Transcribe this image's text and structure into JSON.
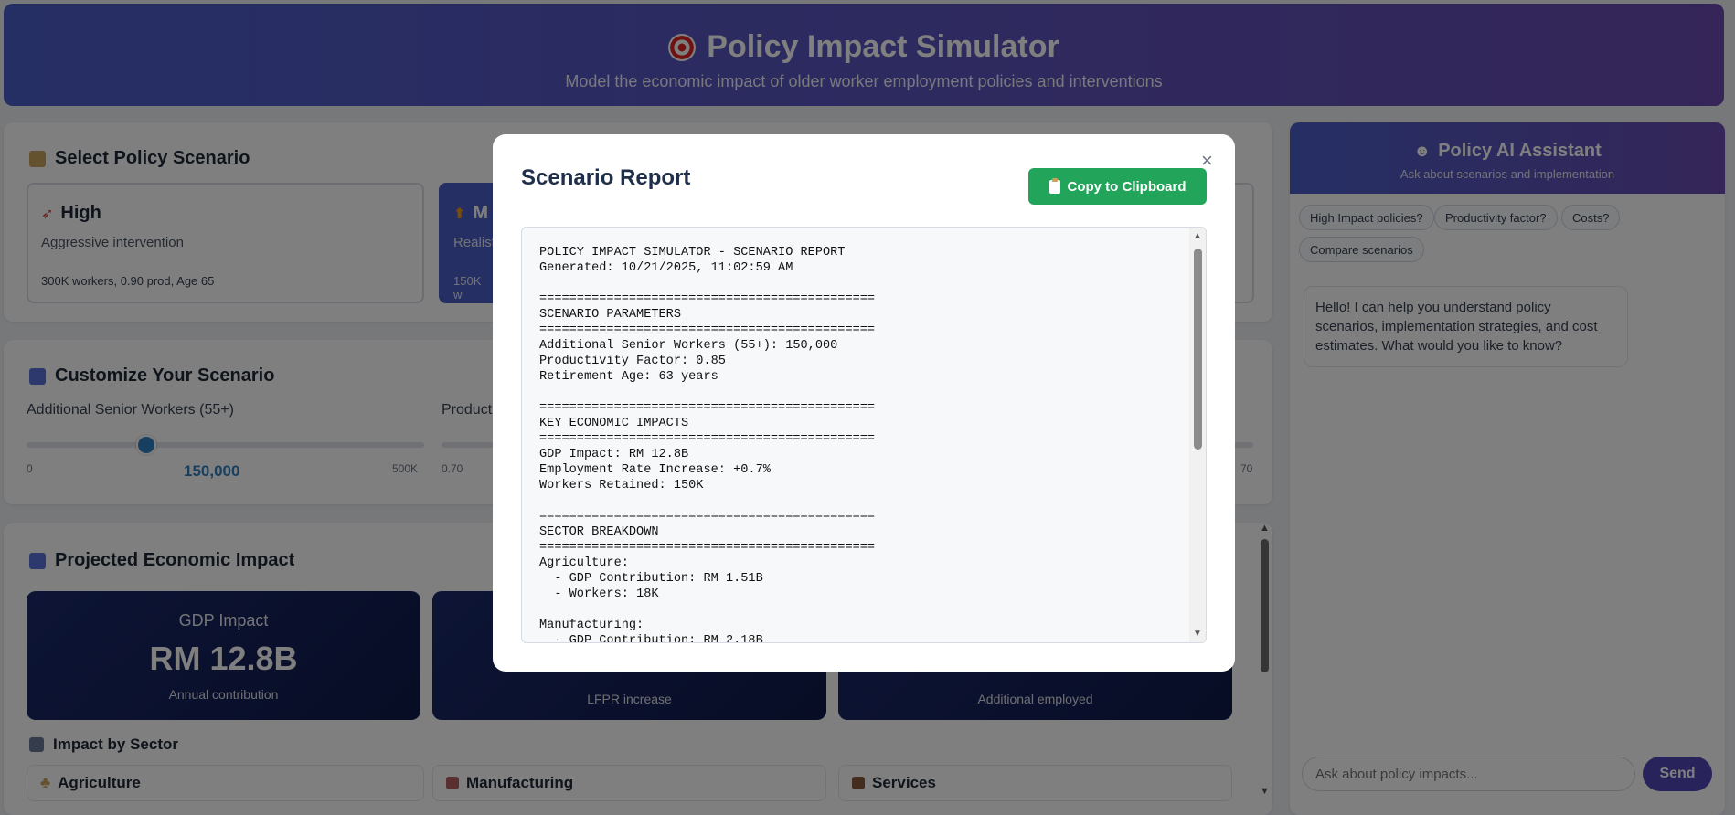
{
  "header": {
    "title": "Policy Impact Simulator",
    "subtitle": "Model the economic impact of older worker employment policies and interventions"
  },
  "scenario_section": {
    "title": "Select Policy Scenario",
    "cards": [
      {
        "name": "High",
        "desc": "Aggressive intervention",
        "meta": "300K workers, 0.90 prod, Age 65"
      },
      {
        "name": "M",
        "desc": "Realist",
        "meta": "150K w"
      }
    ]
  },
  "customize_section": {
    "title": "Customize Your Scenario",
    "sliders": [
      {
        "label": "Additional Senior Workers (55+)",
        "min": "0",
        "max": "500K",
        "value": "150,000",
        "fraction": 0.3
      },
      {
        "label": "Product",
        "min": "0.70",
        "max": "70"
      }
    ]
  },
  "impact_section": {
    "title": "Projected Economic Impact",
    "metrics": [
      {
        "label": "GDP Impact",
        "value": "RM 12.8B",
        "sub": "Annual contribution"
      },
      {
        "label": "",
        "value": "",
        "sub": "LFPR increase"
      },
      {
        "label": "",
        "value": "",
        "sub": "Additional employed"
      }
    ],
    "sector_title": "Impact by Sector",
    "sectors": [
      "Agriculture",
      "Manufacturing",
      "Services"
    ]
  },
  "chat": {
    "title": "Policy AI Assistant",
    "subtitle": "Ask about scenarios and implementation",
    "chips": [
      "High Impact policies?",
      "Productivity factor?",
      "Costs?",
      "Compare scenarios"
    ],
    "greeting": "Hello! I can help you understand policy scenarios, implementation strategies, and cost estimates. What would you like to know?",
    "input_placeholder": "Ask about policy impacts...",
    "send_label": "Send"
  },
  "modal": {
    "title": "Scenario Report",
    "close_label": "×",
    "copy_label": "Copy to Clipboard",
    "report": "POLICY IMPACT SIMULATOR - SCENARIO REPORT\nGenerated: 10/21/2025, 11:02:59 AM\n\n=============================================\nSCENARIO PARAMETERS\n=============================================\nAdditional Senior Workers (55+): 150,000\nProductivity Factor: 0.85\nRetirement Age: 63 years\n\n=============================================\nKEY ECONOMIC IMPACTS\n=============================================\nGDP Impact: RM 12.8B\nEmployment Rate Increase: +0.7%\nWorkers Retained: 150K\n\n=============================================\nSECTOR BREAKDOWN\n=============================================\nAgriculture:\n  - GDP Contribution: RM 1.51B\n  - Workers: 18K\n\nManufacturing:\n  - GDP Contribution: RM 2.18B"
  }
}
